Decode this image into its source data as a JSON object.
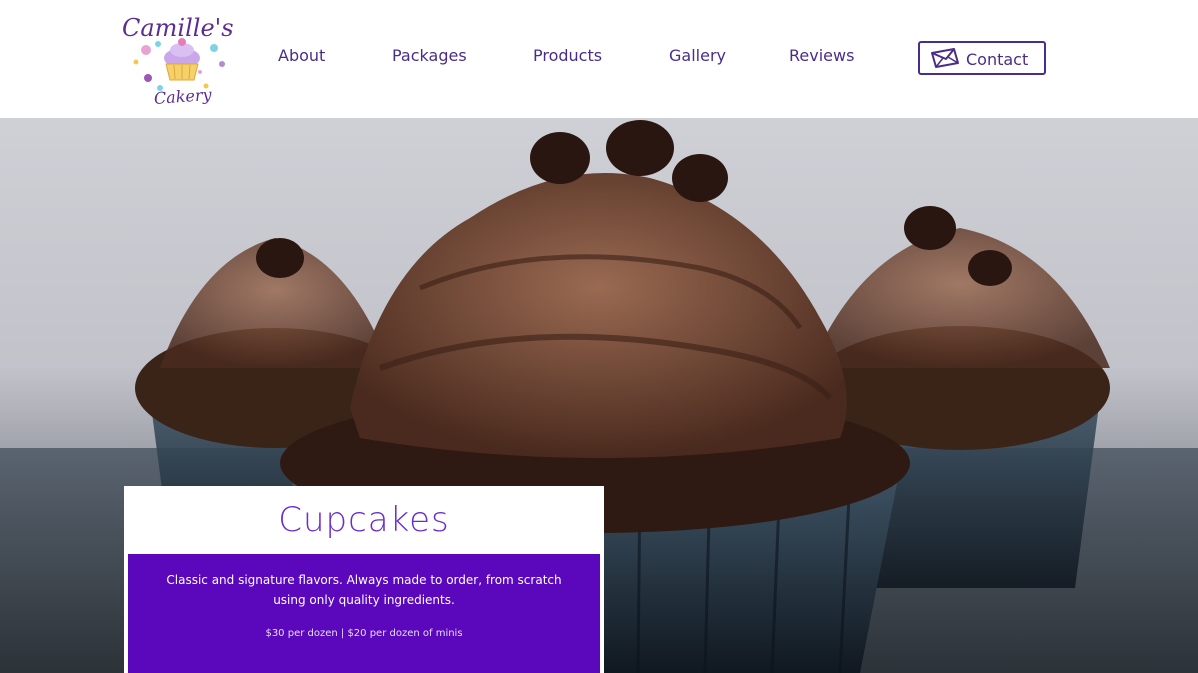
{
  "brand": {
    "logo_text_line1": "Camille's",
    "logo_text_line2": "Cakery"
  },
  "nav": {
    "items": [
      {
        "label": "About"
      },
      {
        "label": "Packages"
      },
      {
        "label": "Products"
      },
      {
        "label": "Gallery"
      },
      {
        "label": "Reviews"
      }
    ],
    "contact_label": "Contact"
  },
  "colors": {
    "accent_purple": "#5b08bd",
    "title_purple": "#6a2fc9",
    "nav_text": "#4a2d8a"
  },
  "hero": {
    "image_alt": "chocolate-frosted cupcakes"
  },
  "card": {
    "title": "Cupcakes",
    "description": "Classic and signature flavors. Always made to order, from scratch using only quality ingredients.",
    "price": "$30 per dozen | $20 per dozen of minis"
  }
}
